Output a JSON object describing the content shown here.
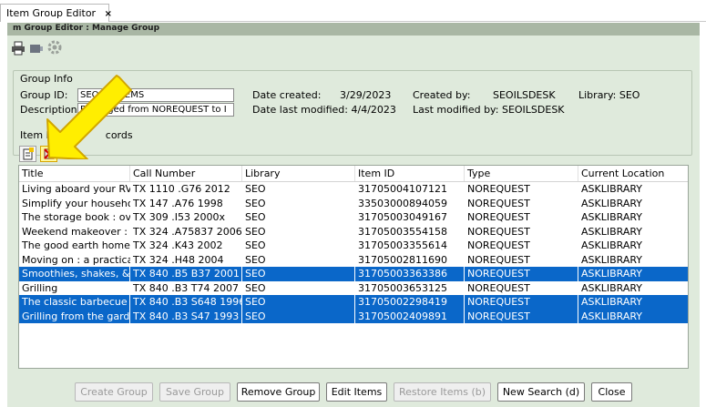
{
  "tab": {
    "title": "Item Group Editor",
    "close": "×"
  },
  "header": {
    "title": "m Group Editor : Manage Group"
  },
  "toolbar": [
    {
      "icon": "printer-icon"
    },
    {
      "icon": "folder-icon"
    },
    {
      "icon": "gear-icon"
    }
  ],
  "group_info": {
    "legend": "Group Info",
    "group_id_label": "Group ID:",
    "group_id_value": "SEO TX ITEMS",
    "description_label": "Description:",
    "description_value": "BN  ... ged from NOREQUEST to I",
    "date_created_label": "Date created:",
    "date_created_value": "3/29/2023",
    "created_by_label": "Created by:",
    "created_by_value": "SEOILSDESK",
    "library_label": "Library: SEO",
    "date_modified_label": "Date last modified: 4/4/2023",
    "modified_by_label": "Last modified by: SEOILSDESK"
  },
  "item_list": {
    "legend": "Item List",
    "legend_tail": "cords",
    "add_icon": "add-record-icon",
    "remove_icon": "remove-record-icon"
  },
  "table": {
    "columns": [
      "Title",
      "Call Number",
      "Library",
      "Item ID",
      "Type",
      "Current Location"
    ],
    "rows": [
      {
        "cells": [
          "Living aboard your RV",
          "TX 1110 .G76 2012",
          "SEO",
          "31705004107121",
          "NOREQUEST",
          "ASKLIBRARY"
        ],
        "selected": false
      },
      {
        "cells": [
          "Simplify your household",
          "TX 147 .A76 1998",
          "SEO",
          "33503000894059",
          "NOREQUEST",
          "ASKLIBRARY"
        ],
        "selected": false
      },
      {
        "cells": [
          "The storage book : ov...",
          "TX 309 .I53 2000x",
          "SEO",
          "31705003049167",
          "NOREQUEST",
          "ASKLIBRARY"
        ],
        "selected": false
      },
      {
        "cells": [
          "Weekend makeover : ...",
          "TX 324 .A75837 2006",
          "SEO",
          "31705003554158",
          "NOREQUEST",
          "ASKLIBRARY"
        ],
        "selected": false
      },
      {
        "cells": [
          "The good earth home ...",
          "TX 324 .K43 2002",
          "SEO",
          "31705003355614",
          "NOREQUEST",
          "ASKLIBRARY"
        ],
        "selected": false
      },
      {
        "cells": [
          "Moving on : a practica...",
          "TX 324 .H48 2004",
          "SEO",
          "31705002811690",
          "NOREQUEST",
          "ASKLIBRARY"
        ],
        "selected": false
      },
      {
        "cells": [
          "Smoothies, shakes, & ...",
          "TX 840 .B5 B37 2001",
          "SEO",
          "31705003363386",
          "NOREQUEST",
          "ASKLIBRARY"
        ],
        "selected": true
      },
      {
        "cells": [
          "Grilling",
          "TX 840 .B3 T74 2007",
          "SEO",
          "31705003653125",
          "NOREQUEST",
          "ASKLIBRARY"
        ],
        "selected": false
      },
      {
        "cells": [
          "The classic barbecue ...",
          "TX 840 .B3 S648 1996",
          "SEO",
          "31705002298419",
          "NOREQUEST",
          "ASKLIBRARY"
        ],
        "selected": true
      },
      {
        "cells": [
          "Grilling from the gard...",
          "TX 840 .B3 S47 1993",
          "SEO",
          "31705002409891",
          "NOREQUEST",
          "ASKLIBRARY"
        ],
        "selected": true
      }
    ]
  },
  "buttons": {
    "create_group": "Create Group",
    "save_group": "Save Group",
    "remove_group": "Remove Group",
    "edit_items": "Edit Items",
    "restore_items": "Restore Items (b)",
    "new_search": "New Search (d)",
    "close": "Close"
  },
  "colors": {
    "panel_bg": "#dfeadc",
    "header_bg": "#a9b7a4",
    "selected_row": "#0a67c9",
    "highlight_arrow": "#ffee00"
  }
}
